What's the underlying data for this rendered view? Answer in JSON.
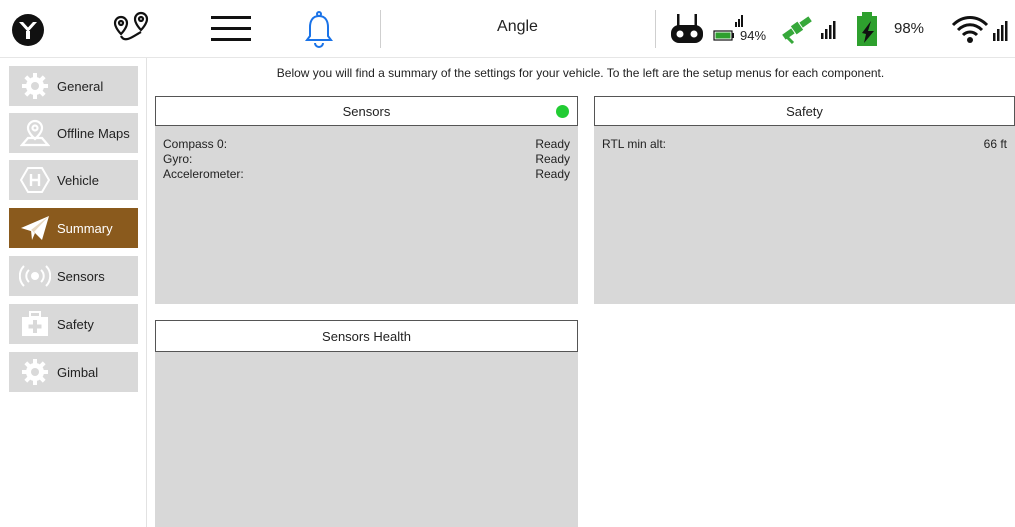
{
  "toolbar": {
    "mode": "Angle",
    "rc_battery_percent": "94%",
    "vehicle_battery_percent": "98%",
    "icons": [
      "app-logo-icon",
      "plan-route-icon",
      "hamburger-menu-icon",
      "bell-icon",
      "remote-controller-icon",
      "battery-icon",
      "gps-satellite-icon",
      "vehicle-battery-icon",
      "wifi-icon"
    ],
    "colors": {
      "bell": "#1a73e8",
      "battery_green": "#2ea02e",
      "satellite_green": "#36a83a"
    }
  },
  "sidebar": {
    "items": [
      {
        "label": "General",
        "icon": "gear-icon",
        "active": false
      },
      {
        "label": "Offline Maps",
        "icon": "map-pin-icon",
        "active": false
      },
      {
        "label": "Vehicle",
        "icon": "hexacopter-icon",
        "active": false
      },
      {
        "label": "Summary",
        "icon": "paper-plane-icon",
        "active": true
      },
      {
        "label": "Sensors",
        "icon": "radio-waves-icon",
        "active": false
      },
      {
        "label": "Safety",
        "icon": "first-aid-icon",
        "active": false
      },
      {
        "label": "Gimbal",
        "icon": "gear-icon",
        "active": false
      }
    ],
    "active_color": "#8a5a1d"
  },
  "main": {
    "message": "Below you will find a summary of the settings for your vehicle. To the left are the setup menus for each component.",
    "sensors": {
      "title": "Sensors",
      "status_color": "#22cc33",
      "rows": [
        {
          "name": "Compass 0:",
          "value": "Ready"
        },
        {
          "name": "Gyro:",
          "value": "Ready"
        },
        {
          "name": "Accelerometer:",
          "value": "Ready"
        }
      ]
    },
    "safety": {
      "title": "Safety",
      "rows": [
        {
          "name": "RTL min alt:",
          "value": "66 ft"
        }
      ]
    },
    "sensors_health": {
      "title": "Sensors Health"
    }
  }
}
